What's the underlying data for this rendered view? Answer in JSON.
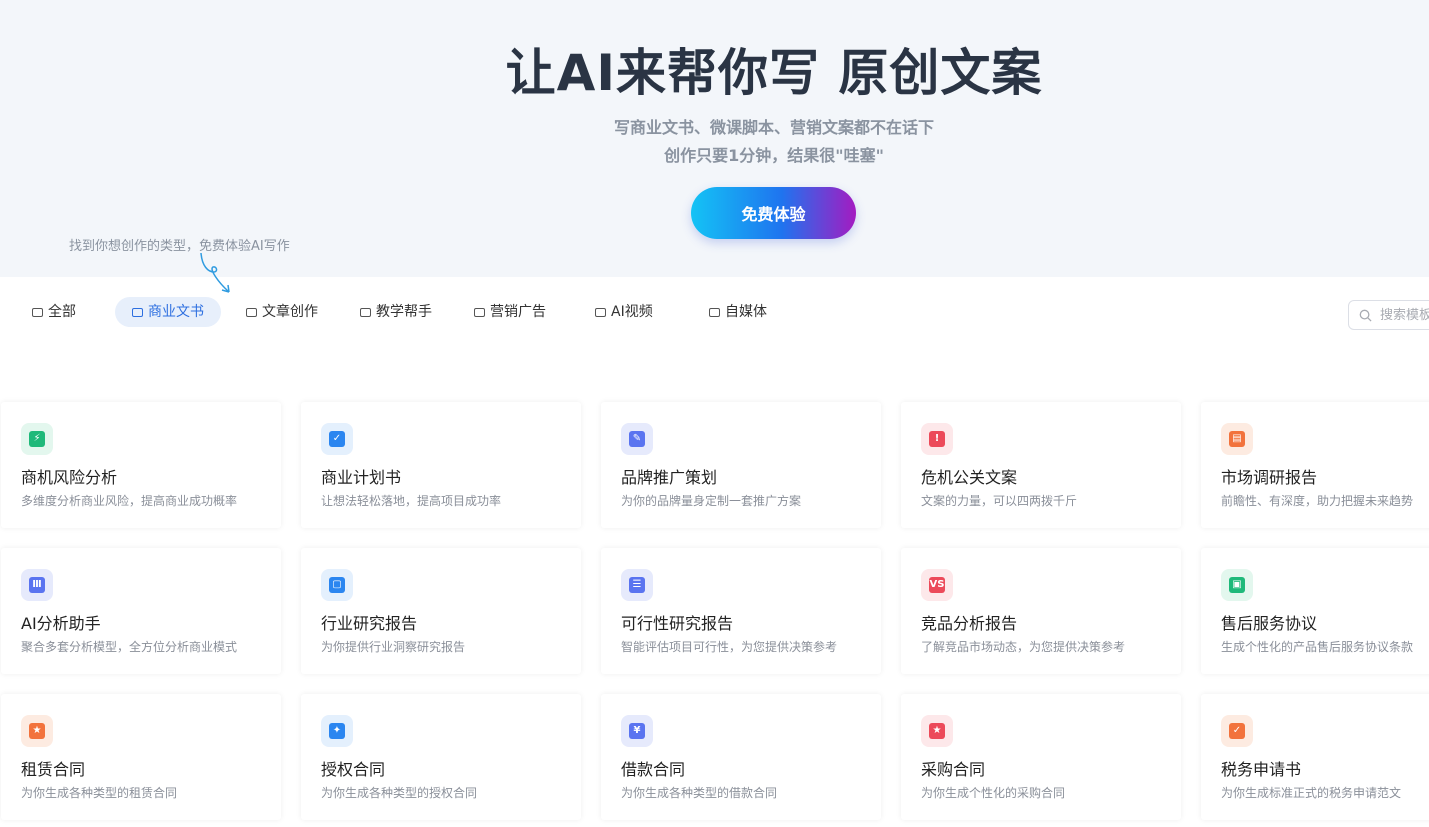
{
  "hero": {
    "title": "让AI来帮你写 原创文案",
    "subtitle_1": "写商业文书、微课脚本、营销文案都不在话下",
    "subtitle_2": "创作只要1分钟，结果很\"哇塞\"",
    "cta_label": "免费体验",
    "hint": "找到你想创作的类型，免费体验AI写作"
  },
  "tabs": [
    {
      "label": "全部",
      "active": false
    },
    {
      "label": "商业文书",
      "active": true
    },
    {
      "label": "文章创作",
      "active": false
    },
    {
      "label": "教学帮手",
      "active": false
    },
    {
      "label": "营销广告",
      "active": false
    },
    {
      "label": "AI视频",
      "active": false
    },
    {
      "label": "自媒体",
      "active": false
    }
  ],
  "search": {
    "placeholder": "搜索模板"
  },
  "cards": [
    {
      "title": "商机风险分析",
      "desc": "多维度分析商业风险，提高商业成功概率",
      "icon": "shield-bolt-icon",
      "bg": "#e3f7ee",
      "fg": "#1fb97a"
    },
    {
      "title": "商业计划书",
      "desc": "让想法轻松落地，提高项目成功率",
      "icon": "clipboard-check-icon",
      "bg": "#e4f0fd",
      "fg": "#2b86f0"
    },
    {
      "title": "品牌推广策划",
      "desc": "为你的品牌量身定制一套推广方案",
      "icon": "pencil-icon",
      "bg": "#e6eafc",
      "fg": "#5a74f0"
    },
    {
      "title": "危机公关文案",
      "desc": "文案的力量，可以四两拨千斤",
      "icon": "warning-icon",
      "bg": "#fde8ea",
      "fg": "#ec4a5a"
    },
    {
      "title": "市场调研报告",
      "desc": "前瞻性、有深度，助力把握未来趋势",
      "icon": "report-icon",
      "bg": "#fdebe1",
      "fg": "#f2733d"
    },
    {
      "title": "AI分析助手",
      "desc": "聚合多套分析模型，全方位分析商业模式",
      "icon": "bar-chart-icon",
      "bg": "#e6eafc",
      "fg": "#5a74f0"
    },
    {
      "title": "行业研究报告",
      "desc": "为你提供行业洞察研究报告",
      "icon": "document-icon",
      "bg": "#e4f0fd",
      "fg": "#2b86f0"
    },
    {
      "title": "可行性研究报告",
      "desc": "智能评估项目可行性，为您提供决策参考",
      "icon": "checklist-icon",
      "bg": "#e6eafc",
      "fg": "#5a74f0"
    },
    {
      "title": "竞品分析报告",
      "desc": "了解竞品市场动态，为您提供决策参考",
      "icon": "versus-icon",
      "bg": "#fde8ea",
      "fg": "#ec4a5a"
    },
    {
      "title": "售后服务协议",
      "desc": "生成个性化的产品售后服务协议条款",
      "icon": "contract-icon",
      "bg": "#e3f7ee",
      "fg": "#1fb97a"
    },
    {
      "title": "租赁合同",
      "desc": "为你生成各种类型的租赁合同",
      "icon": "lease-icon",
      "bg": "#fdebe1",
      "fg": "#f2733d"
    },
    {
      "title": "授权合同",
      "desc": "为你生成各种类型的授权合同",
      "icon": "license-icon",
      "bg": "#e4f0fd",
      "fg": "#2b86f0"
    },
    {
      "title": "借款合同",
      "desc": "为你生成各种类型的借款合同",
      "icon": "loan-icon",
      "bg": "#e6eafc",
      "fg": "#5a74f0"
    },
    {
      "title": "采购合同",
      "desc": "为你生成个性化的采购合同",
      "icon": "purchase-icon",
      "bg": "#fde8ea",
      "fg": "#ec4a5a"
    },
    {
      "title": "税务申请书",
      "desc": "为你生成标准正式的税务申请范文",
      "icon": "tax-icon",
      "bg": "#fdebe1",
      "fg": "#f2733d"
    }
  ]
}
